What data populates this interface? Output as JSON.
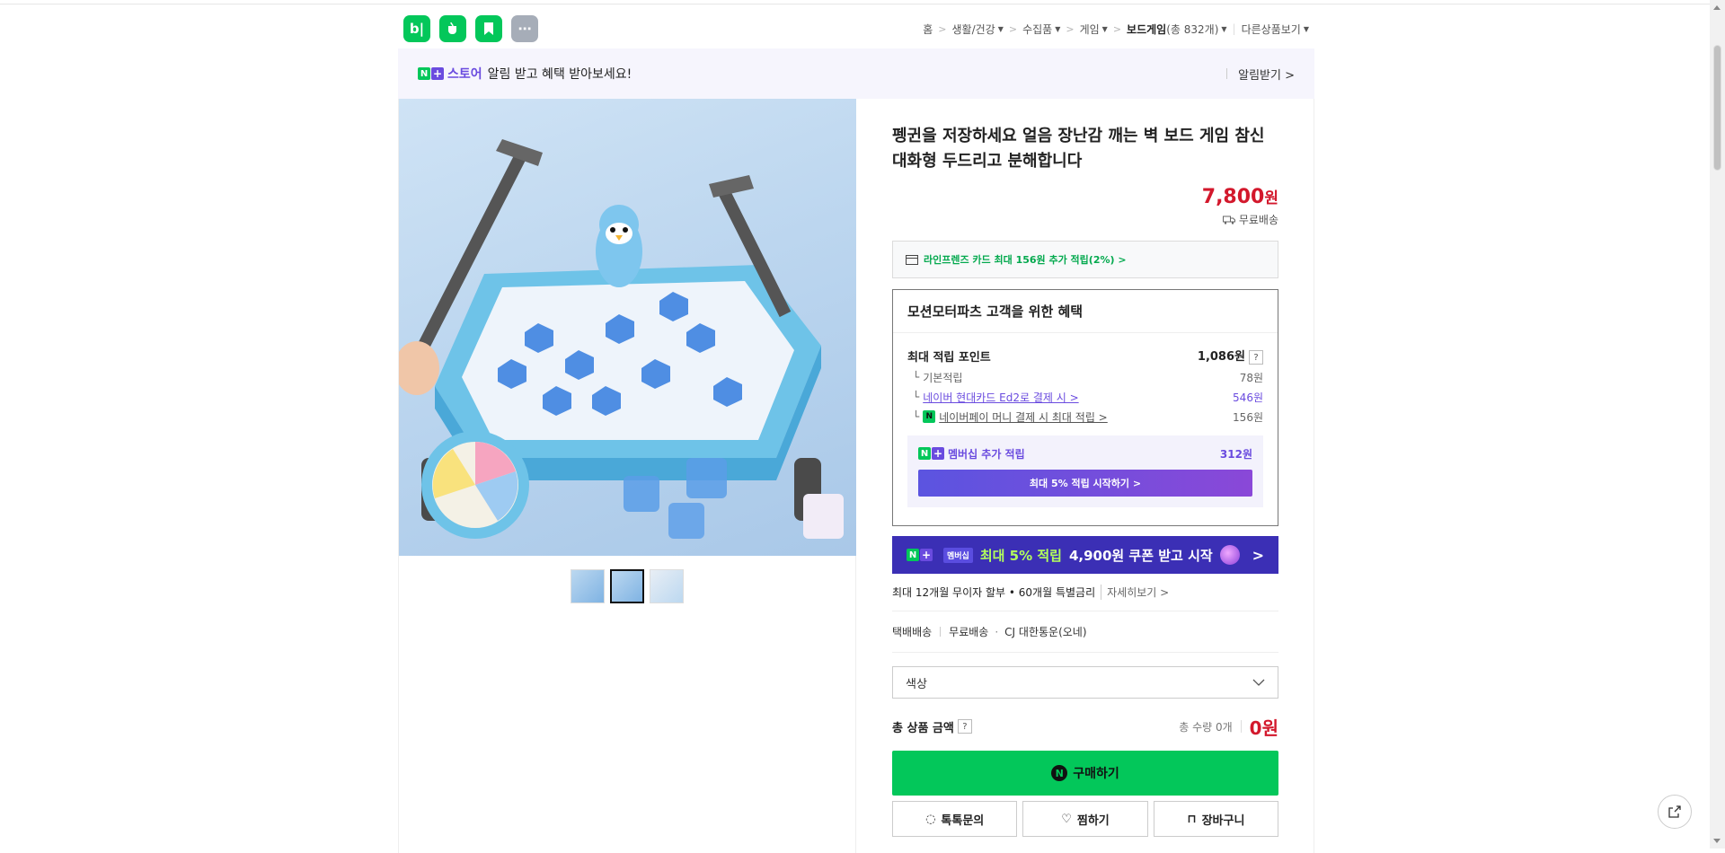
{
  "header": {
    "apps": [
      {
        "label": "b|",
        "icon": "blog-app-icon"
      },
      {
        "label": "",
        "icon": "cafe-app-icon"
      },
      {
        "label": "",
        "icon": "bookmark-app-icon"
      },
      {
        "label": "⋯",
        "icon": "more-apps-icon"
      }
    ],
    "breadcrumb": {
      "home": "홈",
      "cat1": "생활/건강",
      "cat2": "수집품",
      "cat3": "게임",
      "cat4": "보드게임",
      "cat4_count": "(총 832개)",
      "other": "다른상품보기"
    }
  },
  "store_banner": {
    "n_badge": "N",
    "plus_badge": "+",
    "store_label": "스토어",
    "message": "알림 받고 혜택 받아보세요!",
    "action": "알림받기 >"
  },
  "product": {
    "title": "펭귄을 저장하세요 얼음 장난감 깨는 벽 보드 게임 참신 대화형 두드리고 분해합니다",
    "price": "7,800",
    "price_unit": "원",
    "shipping": "무료배송",
    "card_promo": "라인프렌즈 카드 최대 156원 추가 적립(2%) >"
  },
  "benefit": {
    "heading": "모션모터파츠 고객을 위한 혜택",
    "max_points_label": "최대 적립 포인트",
    "max_points_value": "1,086원",
    "rows": [
      {
        "label": "기본적립",
        "value": "78원"
      },
      {
        "label": "네이버 현대카드 Ed2로 결제 시 >",
        "value": "546원"
      },
      {
        "label": "네이버페이 머니 결제 시 최대 적립 >",
        "value": "156원"
      }
    ],
    "membership_label": "멤버십 추가 적립",
    "membership_value": "312원",
    "membership_button": "최대 5% 적립 시작하기 >"
  },
  "promo_banner": {
    "tag": "멤버십",
    "text_highlight": "최대 5% 적립",
    "text_rest": "4,900원 쿠폰 받고 시작",
    "chevron": ">"
  },
  "installment": {
    "text": "최대 12개월 무이자 할부 • 60개월 특별금리",
    "link": "자세히보기 >"
  },
  "delivery": {
    "method": "택배배송",
    "fee": "무료배송",
    "courier": "CJ 대한통운(오네)"
  },
  "option_select": {
    "placeholder": "색상"
  },
  "total": {
    "label": "총 상품 금액",
    "qty": "총 수량 0개",
    "amount": "0원"
  },
  "actions": {
    "buy": "구매하기",
    "talk": "톡톡문의",
    "wish": "찜하기",
    "cart": "장바구니"
  },
  "colors": {
    "naver_green": "#03c75a",
    "price_red": "#d3182c",
    "purple": "#6a4bdf"
  }
}
